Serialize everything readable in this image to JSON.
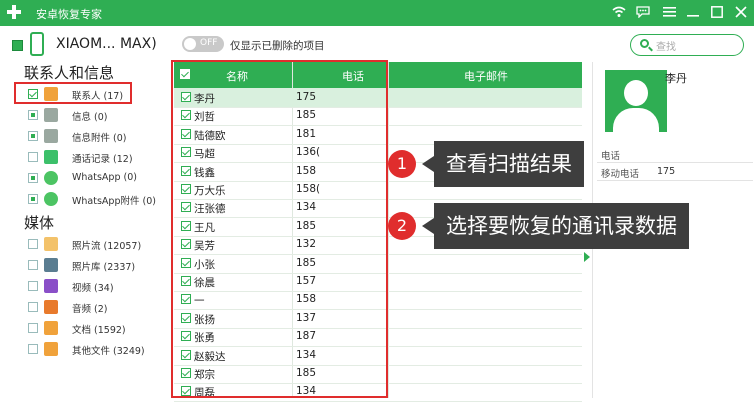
{
  "app": {
    "title": "安卓恢复专家",
    "device_name": "XIAOM... MAX)",
    "toggle_state": "OFF",
    "toggle_label": "仅显示已删除的项目",
    "search_placeholder": "查找"
  },
  "sidebar": {
    "section1": "联系人和信息",
    "section2": "媒体",
    "items1": [
      {
        "label": "联系人 (17)",
        "icon": "contacts-icon",
        "color": "#f0a23b"
      },
      {
        "label": "信息 (0)",
        "icon": "message-icon",
        "color": "#9aa8a0"
      },
      {
        "label": "信息附件 (0)",
        "icon": "attachment-icon",
        "color": "#9aa8a0"
      },
      {
        "label": "通话记录 (12)",
        "icon": "call-log-icon",
        "color": "#3cc06a"
      },
      {
        "label": "WhatsApp (0)",
        "icon": "whatsapp-icon",
        "color": "#4cc463"
      },
      {
        "label": "WhatsApp附件 (0)",
        "icon": "whatsapp-attachment-icon",
        "color": "#4cc463"
      }
    ],
    "items2": [
      {
        "label": "照片流 (12057)",
        "icon": "photo-stream-icon",
        "color": "#f3c26a"
      },
      {
        "label": "照片库 (2337)",
        "icon": "photo-library-icon",
        "color": "#5a7d91"
      },
      {
        "label": "视频 (34)",
        "icon": "video-icon",
        "color": "#8a4fc8"
      },
      {
        "label": "音频 (2)",
        "icon": "audio-icon",
        "color": "#e87a2c"
      },
      {
        "label": "文档 (1592)",
        "icon": "document-icon",
        "color": "#f0a23b"
      },
      {
        "label": "其他文件 (3249)",
        "icon": "other-files-icon",
        "color": "#f0a23b"
      }
    ]
  },
  "table": {
    "headers": {
      "name": "名称",
      "phone": "电话",
      "email": "电子邮件"
    },
    "rows": [
      {
        "name": "李丹",
        "phone": "175"
      },
      {
        "name": "刘哲",
        "phone": "185"
      },
      {
        "name": "陆德欧",
        "phone": "181"
      },
      {
        "name": "马超",
        "phone": "136("
      },
      {
        "name": "钱鑫",
        "phone": "158"
      },
      {
        "name": "万大乐",
        "phone": "158("
      },
      {
        "name": "汪张德",
        "phone": "134"
      },
      {
        "name": "王凡",
        "phone": "185"
      },
      {
        "name": "吴芳",
        "phone": "132"
      },
      {
        "name": "小张",
        "phone": "185"
      },
      {
        "name": "徐晨",
        "phone": "157"
      },
      {
        "name": "一",
        "phone": "158"
      },
      {
        "name": "张扬",
        "phone": "137"
      },
      {
        "name": "张勇",
        "phone": "187"
      },
      {
        "name": "赵毅达",
        "phone": "134"
      },
      {
        "name": "郑宗",
        "phone": "185"
      },
      {
        "name": "周磊",
        "phone": "134"
      }
    ]
  },
  "detail": {
    "name": "李丹",
    "phone_label": "电话",
    "mobile_label": "移动电话",
    "mobile_value": "175"
  },
  "callouts": [
    {
      "num": "1",
      "text": "查看扫描结果"
    },
    {
      "num": "2",
      "text": "选择要恢复的通讯录数据"
    }
  ],
  "colors": {
    "brand": "#2fae53",
    "highlight": "#e02d2d",
    "callout_bg": "#3e3e3e"
  }
}
